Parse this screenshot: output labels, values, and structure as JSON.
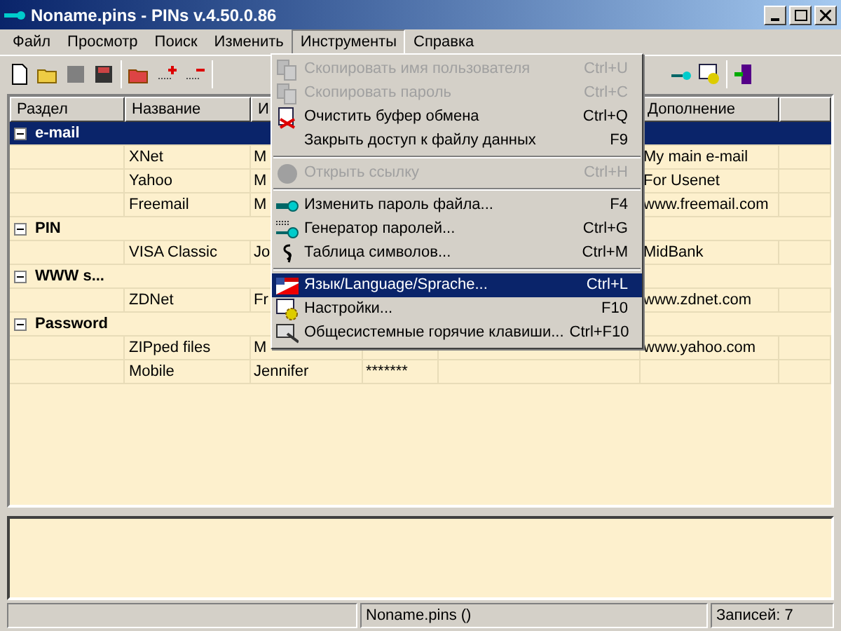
{
  "window": {
    "title": "Noname.pins - PINs v.4.50.0.86"
  },
  "menu_bar": [
    {
      "label": "Файл",
      "selected": false
    },
    {
      "label": "Просмотр",
      "selected": false
    },
    {
      "label": "Поиск",
      "selected": false
    },
    {
      "label": "Изменить",
      "selected": false
    },
    {
      "label": "Инструменты",
      "selected": true
    },
    {
      "label": "Справка",
      "selected": false
    }
  ],
  "table": {
    "columns": {
      "section": "Раздел",
      "name": "Название",
      "column_3": "И",
      "notes": "Дополнение"
    },
    "rows": [
      {
        "kind": "group",
        "label": "e-mail",
        "expanded": true,
        "selected": true
      },
      {
        "kind": "entry",
        "name": "XNet",
        "column_3": "M",
        "notes": "My main e-mail",
        "selected": false
      },
      {
        "kind": "entry",
        "name": "Yahoo",
        "column_3": "M",
        "notes": "For Usenet",
        "selected": false
      },
      {
        "kind": "entry",
        "name": "Freemail",
        "column_3": "M",
        "notes": "www.freemail.com",
        "selected": false
      },
      {
        "kind": "group",
        "label": "PIN",
        "expanded": true,
        "selected": false
      },
      {
        "kind": "entry",
        "name": "VISA Classic",
        "column_3": "Jo",
        "notes": "MidBank",
        "selected": false
      },
      {
        "kind": "group",
        "label": "WWW s...",
        "expanded": true,
        "selected": false
      },
      {
        "kind": "entry",
        "name": "ZDNet",
        "column_3": "Fr",
        "notes": "www.zdnet.com",
        "selected": false
      },
      {
        "kind": "group",
        "label": "Password",
        "expanded": true,
        "selected": false
      },
      {
        "kind": "entry",
        "name": "ZIPped files",
        "column_3": "M",
        "notes": "www.yahoo.com",
        "selected": false
      },
      {
        "kind": "entry",
        "name": "Mobile",
        "column_3": "Jennifer",
        "column_4": "*******",
        "selected": false
      }
    ]
  },
  "dropdown": [
    {
      "kind": "item",
      "label": "Скопировать имя пользователя",
      "shortcut": "Ctrl+U",
      "disabled": true,
      "selected": false
    },
    {
      "kind": "item",
      "label": "Скопировать пароль",
      "shortcut": "Ctrl+C",
      "disabled": true,
      "selected": false
    },
    {
      "kind": "item",
      "label": "Очистить буфер обмена",
      "shortcut": "Ctrl+Q",
      "disabled": false,
      "selected": false
    },
    {
      "kind": "item",
      "label": "Закрыть доступ к файлу данных",
      "shortcut": "F9",
      "disabled": false,
      "selected": false
    },
    {
      "kind": "separator"
    },
    {
      "kind": "item",
      "label": "Открыть ссылку",
      "shortcut": "Ctrl+H",
      "disabled": true,
      "selected": false
    },
    {
      "kind": "separator"
    },
    {
      "kind": "item",
      "label": "Изменить пароль файла...",
      "shortcut": "F4",
      "disabled": false,
      "selected": false
    },
    {
      "kind": "item",
      "label": "Генератор паролей...",
      "shortcut": "Ctrl+G",
      "disabled": false,
      "selected": false
    },
    {
      "kind": "item",
      "label": "Таблица символов...",
      "shortcut": "Ctrl+M",
      "disabled": false,
      "selected": false
    },
    {
      "kind": "separator"
    },
    {
      "kind": "item",
      "label": "Язык/Language/Sprache...",
      "shortcut": "Ctrl+L",
      "disabled": false,
      "selected": true
    },
    {
      "kind": "item",
      "label": "Настройки...",
      "shortcut": "F10",
      "disabled": false,
      "selected": false
    },
    {
      "kind": "item",
      "label": "Общесистемные горячие клавиши...",
      "shortcut": "Ctrl+F10",
      "disabled": false,
      "selected": false
    }
  ],
  "status_bar": {
    "file": "Noname.pins ()",
    "records": "Записей: 7"
  }
}
